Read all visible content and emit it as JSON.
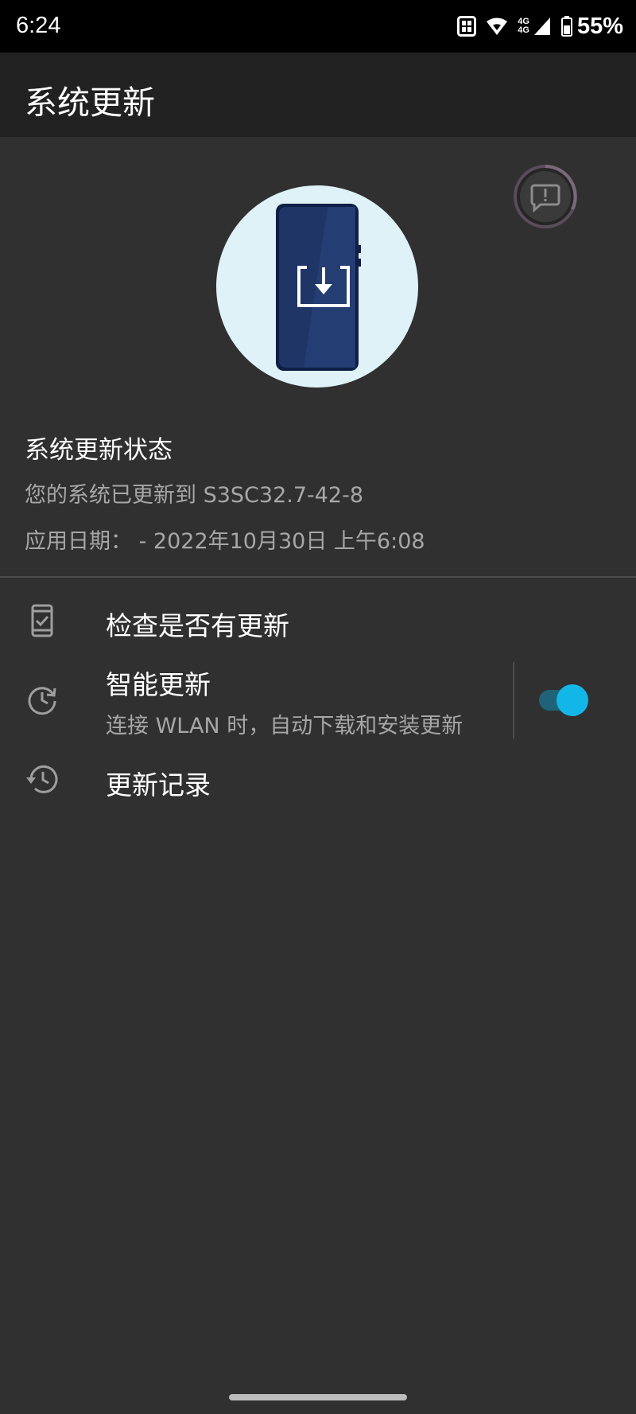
{
  "status_bar": {
    "time": "6:24",
    "network_label_top": "4G",
    "network_label_bottom": "4G",
    "battery": "55%",
    "icons": [
      "nfc-icon",
      "wifi-icon",
      "cellular-signal-icon",
      "battery-icon"
    ]
  },
  "app_bar": {
    "title": "系统更新"
  },
  "status_section": {
    "title": "系统更新状态",
    "version_line": "您的系统已更新到 S3SC32.7-42-8",
    "date_line": "应用日期： - 2022年10月30日 上午6:08"
  },
  "menu": {
    "check_updates": {
      "title": "检查是否有更新",
      "icon": "phone-check-icon"
    },
    "smart_update": {
      "title": "智能更新",
      "subtitle": "连接 WLAN 时，自动下载和安装更新",
      "icon": "clock-refresh-icon",
      "enabled": true
    },
    "history": {
      "title": "更新记录",
      "icon": "history-icon"
    }
  },
  "colors": {
    "background": "#303030",
    "app_bar": "#212121",
    "status_bar": "#000000",
    "accent": "#12b7e8",
    "hero_circle": "#def2f7",
    "phone_body": "#1e3566",
    "secondary_text": "#a7a7a7"
  }
}
